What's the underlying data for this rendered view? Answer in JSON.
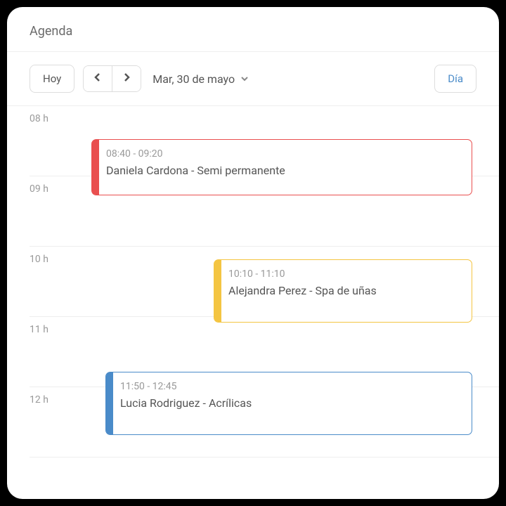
{
  "header": {
    "title": "Agenda"
  },
  "toolbar": {
    "today_label": "Hoy",
    "date_label": "Mar, 30 de mayo",
    "view_label": "Día"
  },
  "hours": {
    "h08": "08 h",
    "h09": "09 h",
    "h10": "10 h",
    "h11": "11 h",
    "h12": "12 h"
  },
  "events": [
    {
      "time": "08:40 - 09:20",
      "title": "Daniela Cardona - Semi permanente",
      "color": "#e94f4f"
    },
    {
      "time": "10:10 - 11:10",
      "title": "Alejandra Perez - Spa de uñas",
      "color": "#f4c542"
    },
    {
      "time": "11:50 - 12:45",
      "title": "Lucia Rodriguez - Acrílicas",
      "color": "#4a8bc9"
    }
  ]
}
